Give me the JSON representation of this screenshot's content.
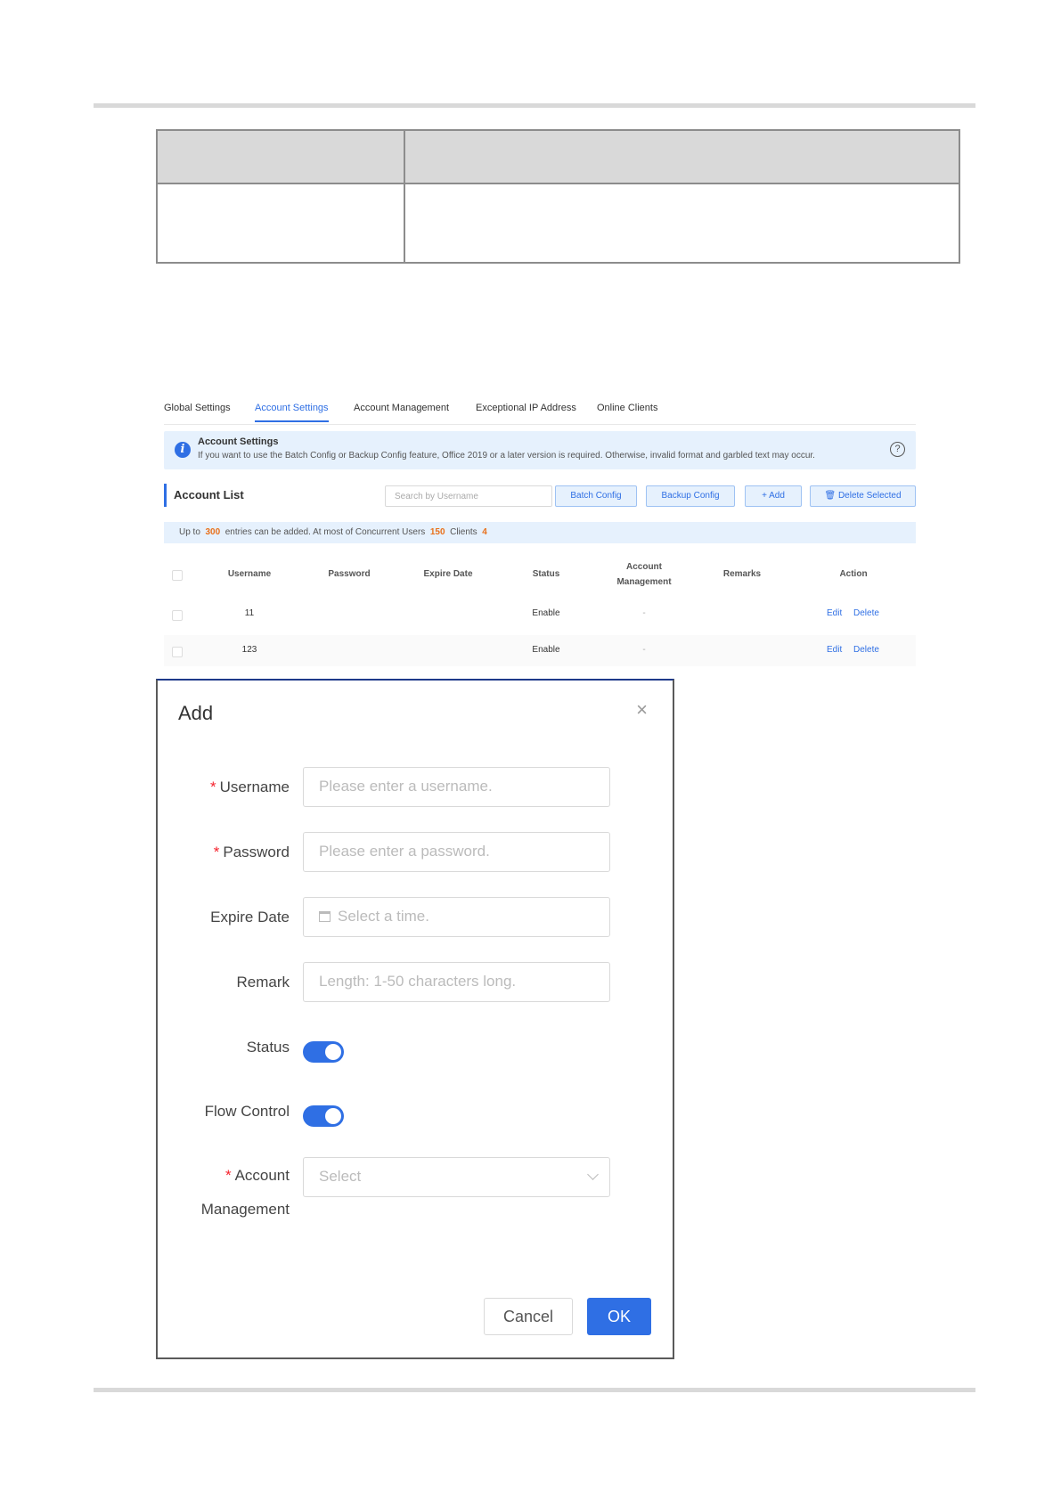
{
  "tabs": [
    "Global Settings",
    "Account Settings",
    "Account Management",
    "Exceptional IP Address",
    "Online Clients"
  ],
  "active_tab": "Account Settings",
  "info": {
    "title": "Account Settings",
    "text": "If you want to use the Batch Config or Backup Config feature, Office 2019 or a later version is required. Otherwise, invalid format and garbled text may occur."
  },
  "account_list": {
    "title": "Account List",
    "search_placeholder": "Search by Username",
    "batch_config": "Batch Config",
    "backup_config": "Backup Config",
    "add": "+ Add",
    "delete_selected": "Delete Selected"
  },
  "limits": {
    "prefix": "Up to",
    "max_entries": "300",
    "middle": "entries can be added. At most of Concurrent Users",
    "max_users": "150",
    "clients_label": "Clients",
    "clients": "4"
  },
  "table": {
    "headers": {
      "username": "Username",
      "password": "Password",
      "expire_date": "Expire Date",
      "status": "Status",
      "account_management_1": "Account",
      "account_management_2": "Management",
      "remarks": "Remarks",
      "action": "Action"
    },
    "rows": [
      {
        "username": "11",
        "status": "Enable",
        "account_management": "-",
        "edit": "Edit",
        "delete": "Delete"
      },
      {
        "username": "123",
        "status": "Enable",
        "account_management": "-",
        "edit": "Edit",
        "delete": "Delete"
      }
    ]
  },
  "modal": {
    "title": "Add",
    "close": "×",
    "username_label": "Username",
    "username_placeholder": "Please enter a username.",
    "password_label": "Password",
    "password_placeholder": "Please enter a password.",
    "expire_label": "Expire Date",
    "expire_placeholder": "Select a time.",
    "remark_label": "Remark",
    "remark_placeholder": "Length: 1-50 characters long.",
    "status_label": "Status",
    "status_on": true,
    "flow_label": "Flow Control",
    "flow_on": true,
    "account_label_1": "Account",
    "account_label_2": "Management",
    "account_placeholder": "Select",
    "required_mark": "*",
    "cancel": "Cancel",
    "ok": "OK"
  },
  "colors": {
    "accent": "#2f6fe4",
    "warning_number": "#e8701a",
    "required": "#f5222d"
  }
}
